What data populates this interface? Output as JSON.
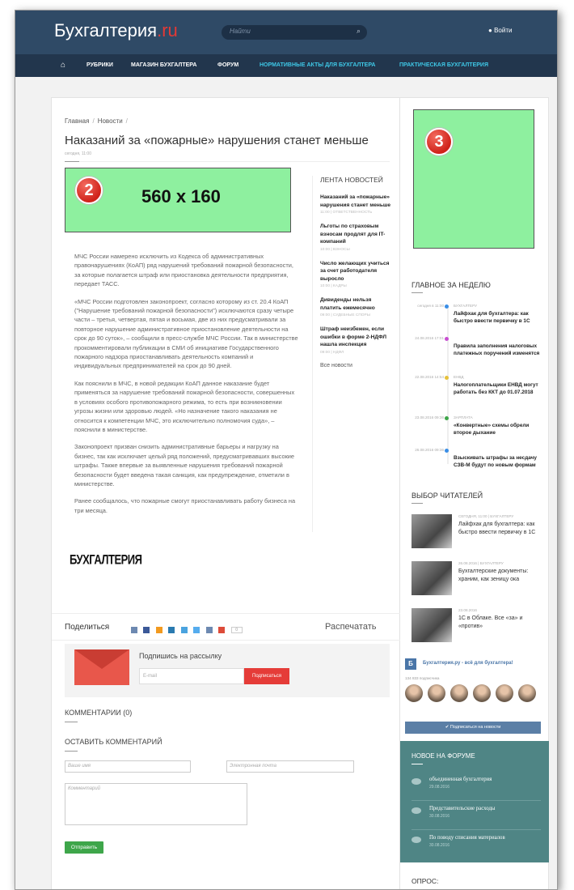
{
  "header": {
    "logo_main": "Бухгалтерия",
    "logo_suffix": ".ru",
    "search_placeholder": "Найти",
    "login": "Войти"
  },
  "nav": {
    "items": [
      "РУБРИКИ",
      "МАГАЗИН БУХГАЛТЕРА",
      "ФОРУМ",
      "НОРМАТИВНЫЕ АКТЫ ДЛЯ БУХГАЛТЕРА",
      "ПРАКТИЧЕСКАЯ БУХГАЛТЕРИЯ"
    ]
  },
  "article": {
    "breadcrumb": [
      "Главная",
      "Новости"
    ],
    "title": "Наказаний за «пожарные» нарушения станет меньше",
    "date": "сегодня, 11:00",
    "paragraphs": [
      "МЧС России намерено исключить из Кодекса об административных правонарушениях (КоАП) ряд нарушений требований пожарной безопасности, за которые полагается штраф или приостановка деятельности предприятия, передает ТАСС.",
      "«МЧС России подготовлен законопроект, согласно которому из ст. 20.4 КоАП (\"Нарушение требований пожарной безопасности\") исключаются сразу четыре части – третья, четвертая, пятая и восьмая, две из них предусматривали за повторное нарушение административное приостановление деятельности на срок до 90 суток», – сообщили в пресс-службе МЧС России. Так в министерстве прокомментировали публикации в СМИ об инициативе Государственного пожарного надзора приостанавливать деятельность компаний и индивидуальных предпринимателей на срок до 90 дней.",
      "Как пояснили в МЧС, в новой редакции КоАП данное наказание будет применяться за нарушение требований пожарной безопасности, совершенных в условиях особого противопожарного режима, то есть при возникновении угрозы жизни или здоровью людей. «Но назначение такого наказания не относится к компетенции МЧС, это исключительно полномочия суда», – пояснили в министерстве.",
      "Законопроект призван снизить административные барьеры и нагрузку на бизнес, так как исключает целый ряд положений, предусматривавших высокие штрафы. Также впервые за выявленные нарушения требований пожарной безопасности будет введена такая санкция, как предупреждение, отметили в министерстве.",
      "Ранее сообщалось, что пожарные смогут приостанавливать работу бизнеса на три месяца."
    ],
    "source_logo": "БУХГАЛТЕРИЯ"
  },
  "ad_main": {
    "badge": "2",
    "size": "560 x 160"
  },
  "ad_side": {
    "badge": "3"
  },
  "feed": {
    "heading": "ЛЕНТА НОВОСТЕЙ",
    "items": [
      {
        "title": "Наказаний за «пожарные» нарушения станет меньше",
        "meta": "11:00 | ОТВЕТСТВЕННОСТЬ"
      },
      {
        "title": "Льготы по страховым взносам продлят для IT-компаний",
        "meta": "10:00 | ВЗНОСЫ"
      },
      {
        "title": "Число желающих учиться за счет работодателя выросло",
        "meta": "10:00 | КАДРЫ"
      },
      {
        "title": "Дивиденды нельзя платить ежемесячно",
        "meta": "09:00 | СУДЕБНЫЕ СПОРЫ"
      },
      {
        "title": "Штраф неизбежен, если ошибки в форме 2-НДФЛ нашла инспекция",
        "meta": "09:00 | НДФЛ"
      }
    ],
    "all": "Все новости"
  },
  "share": {
    "label": "Поделиться",
    "count": "0",
    "print": "Распечатать"
  },
  "subscribe": {
    "title": "Подпишись на рассылку",
    "placeholder": "E-mail",
    "button": "Подписаться"
  },
  "comments": {
    "count_heading": "КОММЕНТАРИИ (0)",
    "leave_heading": "ОСТАВИТЬ КОММЕНТАРИЙ",
    "name_placeholder": "Ваше имя",
    "email_placeholder": "Электронная почта",
    "comment_placeholder": "Комментарий",
    "submit": "Отправить"
  },
  "weekly": {
    "heading": "ГЛАВНОЕ ЗА НЕДЕЛЮ",
    "items": [
      {
        "date": "сегодня в 11:00",
        "category": "БУХГАЛТЕРУ",
        "title": "Лайфхак для бухгалтера: как быстро ввести первичку в 1С",
        "color": "#3a8ee6"
      },
      {
        "date": "24.08.2016 17:01",
        "category": "",
        "title": "Правила заполнения налоговых платежных поручений изменятся",
        "color": "#c84fd1"
      },
      {
        "date": "22.08.2016 14:54",
        "category": "ЕНВД",
        "title": "Налогоплательщики ЕНВД могут работать без ККТ до 01.07.2018",
        "color": "#e6c13a"
      },
      {
        "date": "23.08.2016 09:36",
        "category": "ЗАРПЛАТА",
        "title": "«Конвертные» схемы обрели второе дыхание",
        "color": "#3ea64a"
      },
      {
        "date": "26.08.2016 09:36",
        "category": "",
        "title": "Взыскивать штрафы за несдачу СЗВ-М будут по новым формам",
        "color": "#3a8ee6"
      }
    ]
  },
  "readers": {
    "heading": "ВЫБОР ЧИТАТЕЛЕЙ",
    "items": [
      {
        "meta": "СЕГОДНЯ, 11:00 | БУХГАЛТЕРУ",
        "title": "Лайфхак для бухгалтера: как быстро ввести первичку в 1С"
      },
      {
        "meta": "26.08.2016 | БУХГАЛТЕРУ",
        "title": "Бухгалтерские документы: храним, как зеницу ока"
      },
      {
        "meta": "23.08.2016",
        "title": "1С в Облаке. Все «за» и «против»"
      }
    ]
  },
  "vk": {
    "logo": "Б",
    "name": "Бухгалтерия.ру - всё для бухгалтера!",
    "subscribers": "134 833 подписчика",
    "button": "Подписаться на новости"
  },
  "forum": {
    "heading": "НОВОЕ НА ФОРУМЕ",
    "items": [
      {
        "title": "объединенная бухгалтерия",
        "date": "29.08.2016"
      },
      {
        "title": "Представительские расходы",
        "date": "30.08.2016"
      },
      {
        "title": "По поводу списания материалов",
        "date": "30.08.2016"
      }
    ]
  },
  "poll": {
    "heading": "ОПРОС:"
  }
}
